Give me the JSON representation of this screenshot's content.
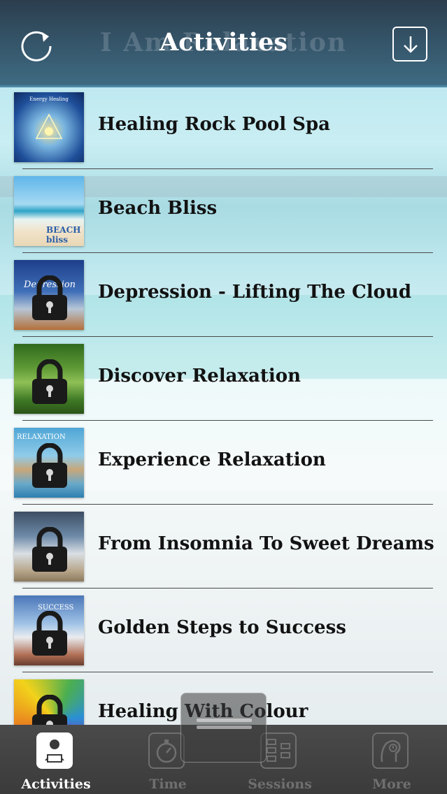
{
  "header": {
    "title": "Activities",
    "ghost_title": "I Am Relaxation",
    "refresh_icon": "refresh-icon",
    "download_icon": "download-arrow-icon"
  },
  "activities": [
    {
      "title": "Healing Rock Pool Spa",
      "locked": false,
      "art_caption": "Energy Healing"
    },
    {
      "title": "Beach Bliss",
      "locked": false,
      "art_caption": "BEACH bliss"
    },
    {
      "title": "Depression - Lifting The Cloud",
      "locked": true,
      "art_caption": "Depression"
    },
    {
      "title": "Discover Relaxation",
      "locked": true,
      "art_caption": ""
    },
    {
      "title": "Experience Relaxation",
      "locked": true,
      "art_caption": "RELAXATION"
    },
    {
      "title": "From Insomnia To Sweet Dreams",
      "locked": true,
      "art_caption": ""
    },
    {
      "title": "Golden Steps to Success",
      "locked": true,
      "art_caption": "SUCCESS"
    },
    {
      "title": "Healing With Colour",
      "locked": true,
      "art_caption": ""
    }
  ],
  "tabbar": {
    "tabs": [
      {
        "label": "Activities",
        "icon": "activities-icon",
        "active": true
      },
      {
        "label": "Time",
        "icon": "stopwatch-icon",
        "active": false
      },
      {
        "label": "Sessions",
        "icon": "sessions-icon",
        "active": false
      },
      {
        "label": "More",
        "icon": "more-icon",
        "active": false
      }
    ]
  },
  "colors": {
    "header_bg": "#36576c",
    "tabbar_bg": "#444444",
    "text": "#121212",
    "inactive_tab": "#6f6f6f"
  }
}
